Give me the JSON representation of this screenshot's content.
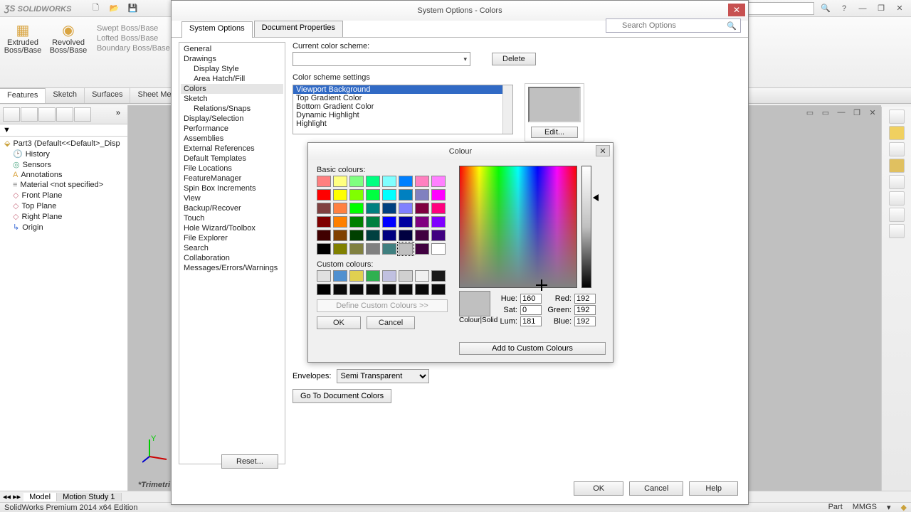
{
  "app": {
    "name": "SOLIDWORKS",
    "help_label": "SolidWorks Help",
    "edition": "SolidWorks Premium 2014 x64 Edition",
    "units": "MMGS",
    "doc_type": "Part"
  },
  "ribbon": {
    "extruded": "Extruded Boss/Base",
    "revolved": "Revolved Boss/Base",
    "swept": "Swept Boss/Base",
    "lofted": "Lofted Boss/Base",
    "boundary": "Boundary Boss/Base",
    "tabs": [
      "Features",
      "Sketch",
      "Surfaces",
      "Sheet Metal"
    ]
  },
  "tree": {
    "root": "Part3 (Default<<Default>_Disp",
    "items": [
      "History",
      "Sensors",
      "Annotations",
      "Material <not specified>",
      "Front Plane",
      "Top Plane",
      "Right Plane",
      "Origin"
    ],
    "trimetric": "*Trimetri"
  },
  "bottom_tabs": {
    "model": "Model",
    "motion": "Motion Study 1"
  },
  "dialog": {
    "title": "System Options - Colors",
    "tabs": [
      "System Options",
      "Document Properties"
    ],
    "search_placeholder": "Search Options",
    "categories": [
      "General",
      "Drawings",
      "Display Style",
      "Area Hatch/Fill",
      "Colors",
      "Sketch",
      "Relations/Snaps",
      "Display/Selection",
      "Performance",
      "Assemblies",
      "External References",
      "Default Templates",
      "File Locations",
      "FeatureManager",
      "Spin Box Increments",
      "View",
      "Backup/Recover",
      "Touch",
      "Hole Wizard/Toolbox",
      "File Explorer",
      "Search",
      "Collaboration",
      "Messages/Errors/Warnings"
    ],
    "selected_category": "Colors",
    "current_scheme_label": "Current color scheme:",
    "delete": "Delete",
    "scheme_settings_label": "Color scheme settings",
    "scheme_items": [
      "Viewport Background",
      "Top Gradient Color",
      "Bottom Gradient Color",
      "Dynamic Highlight",
      "Highlight"
    ],
    "edit": "Edit...",
    "envelopes_label": "Envelopes:",
    "envelopes_value": "Semi Transparent",
    "goto": "Go To Document Colors",
    "reset": "Reset...",
    "ok": "OK",
    "cancel": "Cancel",
    "help": "Help"
  },
  "colour_dialog": {
    "title": "Colour",
    "basic_label": "Basic colours:",
    "custom_label": "Custom colours:",
    "define": "Define Custom Colours >>",
    "ok": "OK",
    "cancel": "Cancel",
    "colour_solid": "Colour|Solid",
    "hue_label": "Hue:",
    "sat_label": "Sat:",
    "lum_label": "Lum:",
    "red_label": "Red:",
    "green_label": "Green:",
    "blue_label": "Blue:",
    "hue": "160",
    "sat": "0",
    "lum": "181",
    "red": "192",
    "green": "192",
    "blue": "192",
    "add": "Add to Custom Colours",
    "basic_colours": [
      "#ff8080",
      "#ffff80",
      "#80ff80",
      "#00ff80",
      "#80ffff",
      "#0080ff",
      "#ff80c0",
      "#ff80ff",
      "#ff0000",
      "#ffff00",
      "#80ff00",
      "#00ff40",
      "#00ffff",
      "#0080c0",
      "#8080c0",
      "#ff00ff",
      "#804040",
      "#ff8040",
      "#00ff00",
      "#008080",
      "#004080",
      "#8080ff",
      "#800040",
      "#ff0080",
      "#800000",
      "#ff8000",
      "#008000",
      "#008040",
      "#0000ff",
      "#0000a0",
      "#800080",
      "#8000ff",
      "#400000",
      "#804000",
      "#004000",
      "#004040",
      "#000080",
      "#000040",
      "#400040",
      "#400080",
      "#000000",
      "#808000",
      "#808040",
      "#808080",
      "#408080",
      "#c0c0c0",
      "#400040",
      "#ffffff"
    ],
    "custom_colours": [
      "#e0e0e0",
      "#5090d0",
      "#e0d050",
      "#30b050",
      "#c0c0e0",
      "#d0d0d0",
      "#f0f0f0",
      "#1a1a1a",
      "#000000",
      "#0a0a0a",
      "#0a0a0a",
      "#0a0a0a",
      "#0a0a0a",
      "#0a0a0a",
      "#0a0a0a",
      "#0a0a0a"
    ]
  }
}
